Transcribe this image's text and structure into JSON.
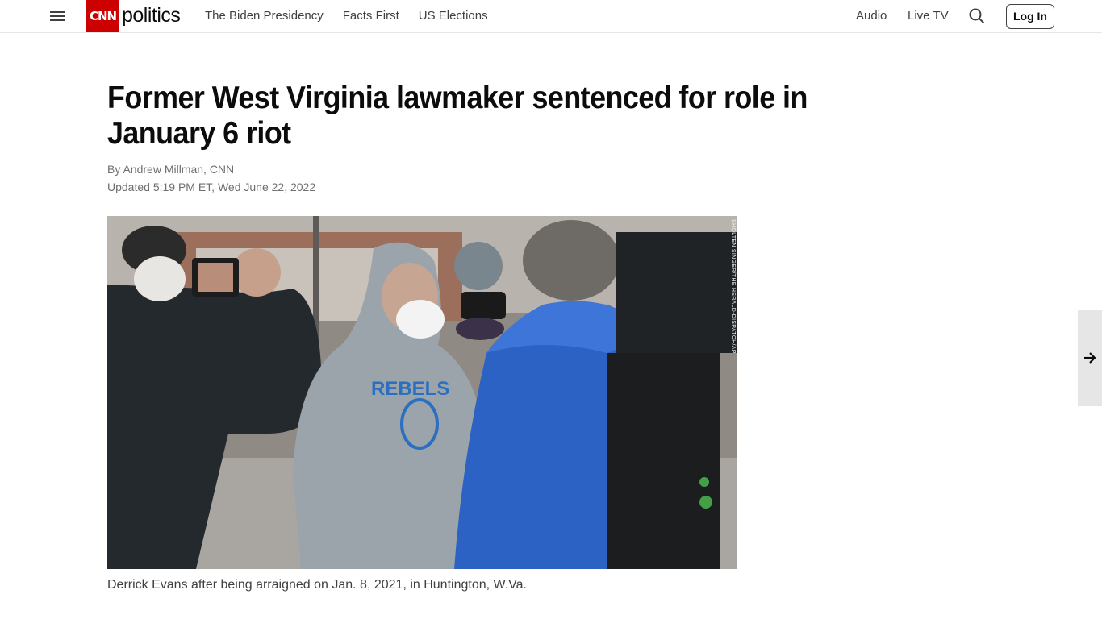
{
  "header": {
    "logo_text": "CNN",
    "section": "politics",
    "nav": [
      "The Biden Presidency",
      "Facts First",
      "US Elections"
    ],
    "audio": "Audio",
    "live_tv": "Live TV",
    "login": "Log In",
    "brand_color": "#cc0000"
  },
  "article": {
    "headline": "Former West Virginia lawmaker sentenced for role in January 6 riot",
    "byline": "By Andrew Millman, CNN",
    "updated": "Updated 5:19 PM ET, Wed June 22, 2022",
    "photo": {
      "credit": "SHOLTEN SINGER/THE HERALD-DISPATCH/AP",
      "sweatshirt_text": "REBELS"
    },
    "caption": "Derrick Evans after being arraigned on Jan. 8, 2021, in Huntington, W.Va."
  },
  "icons": {
    "menu": "hamburger-icon",
    "search": "search-icon",
    "next": "arrow-right-icon"
  }
}
